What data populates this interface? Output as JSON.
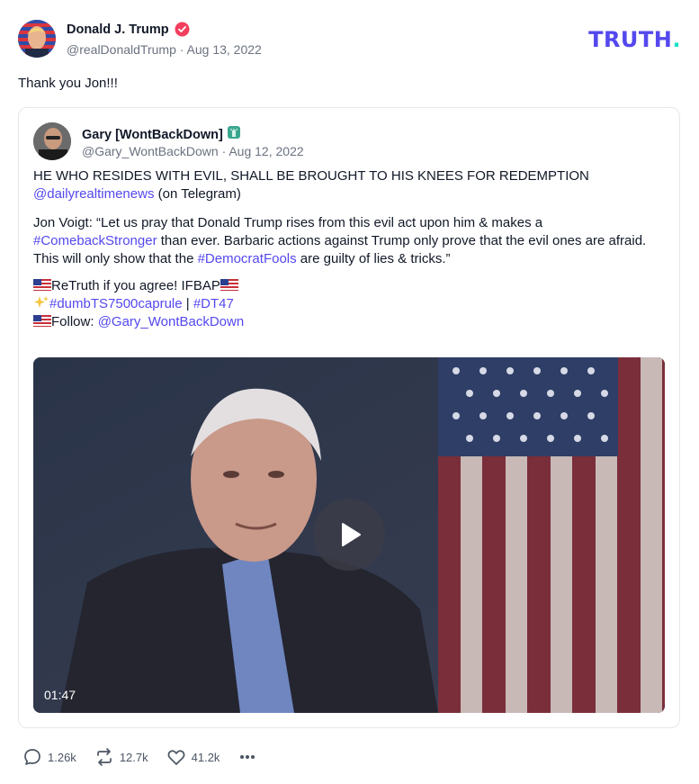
{
  "app": {
    "logo_text": "TRUTH",
    "logo_dot": ".",
    "brand_color": "#5448ee",
    "accent_color": "#17e2c7"
  },
  "post": {
    "author_name": "Donald J. Trump",
    "handle_date": "@realDonaldTrump · Aug 13, 2022",
    "text": "Thank you Jon!!!"
  },
  "quote": {
    "author_name": "Gary [WontBackDown]",
    "name_icon": "statue-of-liberty-icon",
    "handle_date": "@Gary_WontBackDown · Aug 12, 2022",
    "line1": "HE WHO RESIDES WITH EVIL, SHALL BE BROUGHT TO HIS KNEES FOR REDEMPTION",
    "mention_daily": "@dailyrealtimenews",
    "telegram_suffix": " (on Telegram)",
    "voigt_start": "Jon Voigt: “Let us pray that Donald Trump rises from this evil act upon him & makes a",
    "hashtag_comeback": "#ComebackStronger",
    "voigt_mid": " than ever. Barbaric actions against Trump only prove that the evil ones are afraid. This will only show that the ",
    "hashtag_democrat": "#DemocratFools",
    "voigt_end": " are guilty of lies & tricks.”",
    "retruth_text": "ReTruth if you agree!  IFBAP",
    "hashtag_dumb": "#dumbTS7500caprule",
    "pipe": " | ",
    "hashtag_dt47": "#DT47",
    "follow_label": "Follow: ",
    "follow_handle": "@Gary_WontBackDown",
    "video_duration": "01:47"
  },
  "actions": {
    "replies": "1.26k",
    "retruths": "12.7k",
    "likes": "41.2k"
  }
}
